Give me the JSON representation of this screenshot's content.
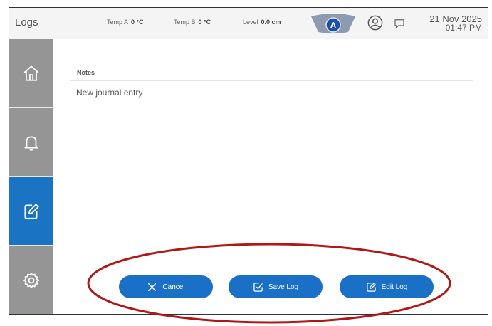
{
  "header": {
    "title": "Logs",
    "sensors": [
      {
        "label": "Temp A",
        "value": "0 °C"
      },
      {
        "label": "Temp B",
        "value": "0 °C"
      },
      {
        "label": "Level",
        "value": "0.0 cm"
      }
    ],
    "mode_letter": "A",
    "date": "21 Nov 2025",
    "time": "01:47 PM"
  },
  "sidebar": {
    "items": [
      {
        "name": "home",
        "icon": "home-icon",
        "active": false
      },
      {
        "name": "alarms",
        "icon": "bell-icon",
        "active": false
      },
      {
        "name": "logs",
        "icon": "edit-icon",
        "active": true
      },
      {
        "name": "settings",
        "icon": "gear-icon",
        "active": false
      }
    ]
  },
  "notes": {
    "label": "Notes",
    "entry": "New journal entry"
  },
  "buttons": {
    "cancel": "Cancel",
    "save": "Save Log",
    "edit": "Edit Log"
  },
  "colors": {
    "accent": "#1a6fc6",
    "sidebar": "#959595",
    "annotation": "#b01818"
  }
}
